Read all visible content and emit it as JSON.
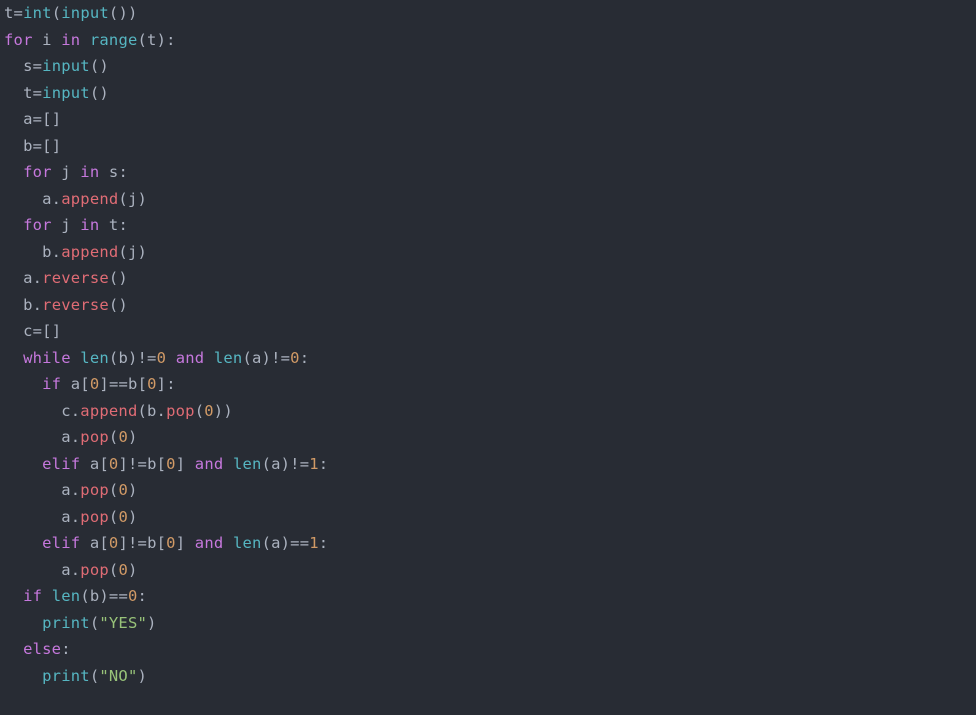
{
  "code": {
    "tokens": [
      [
        {
          "t": "var",
          "v": "t"
        },
        {
          "t": "op",
          "v": "="
        },
        {
          "t": "func",
          "v": "int"
        },
        {
          "t": "punc",
          "v": "("
        },
        {
          "t": "func",
          "v": "input"
        },
        {
          "t": "punc",
          "v": "())"
        }
      ],
      [
        {
          "t": "kw",
          "v": "for"
        },
        {
          "t": "var",
          "v": " i "
        },
        {
          "t": "kw",
          "v": "in"
        },
        {
          "t": "var",
          "v": " "
        },
        {
          "t": "func",
          "v": "range"
        },
        {
          "t": "punc",
          "v": "(t):"
        }
      ],
      [
        {
          "t": "var",
          "v": "  s"
        },
        {
          "t": "op",
          "v": "="
        },
        {
          "t": "func",
          "v": "input"
        },
        {
          "t": "punc",
          "v": "()"
        }
      ],
      [
        {
          "t": "var",
          "v": "  t"
        },
        {
          "t": "op",
          "v": "="
        },
        {
          "t": "func",
          "v": "input"
        },
        {
          "t": "punc",
          "v": "()"
        }
      ],
      [
        {
          "t": "var",
          "v": "  a"
        },
        {
          "t": "op",
          "v": "="
        },
        {
          "t": "punc",
          "v": "[]"
        }
      ],
      [
        {
          "t": "var",
          "v": "  b"
        },
        {
          "t": "op",
          "v": "="
        },
        {
          "t": "punc",
          "v": "[]"
        }
      ],
      [
        {
          "t": "var",
          "v": "  "
        },
        {
          "t": "kw",
          "v": "for"
        },
        {
          "t": "var",
          "v": " j "
        },
        {
          "t": "kw",
          "v": "in"
        },
        {
          "t": "var",
          "v": " s"
        },
        {
          "t": "punc",
          "v": ":"
        }
      ],
      [
        {
          "t": "var",
          "v": "    a"
        },
        {
          "t": "punc",
          "v": "."
        },
        {
          "t": "method",
          "v": "append"
        },
        {
          "t": "punc",
          "v": "(j)"
        }
      ],
      [
        {
          "t": "var",
          "v": "  "
        },
        {
          "t": "kw",
          "v": "for"
        },
        {
          "t": "var",
          "v": " j "
        },
        {
          "t": "kw",
          "v": "in"
        },
        {
          "t": "var",
          "v": " t"
        },
        {
          "t": "punc",
          "v": ":"
        }
      ],
      [
        {
          "t": "var",
          "v": "    b"
        },
        {
          "t": "punc",
          "v": "."
        },
        {
          "t": "method",
          "v": "append"
        },
        {
          "t": "punc",
          "v": "(j)"
        }
      ],
      [
        {
          "t": "var",
          "v": "  a"
        },
        {
          "t": "punc",
          "v": "."
        },
        {
          "t": "method",
          "v": "reverse"
        },
        {
          "t": "punc",
          "v": "()"
        }
      ],
      [
        {
          "t": "var",
          "v": "  b"
        },
        {
          "t": "punc",
          "v": "."
        },
        {
          "t": "method",
          "v": "reverse"
        },
        {
          "t": "punc",
          "v": "()"
        }
      ],
      [
        {
          "t": "var",
          "v": "  c"
        },
        {
          "t": "op",
          "v": "="
        },
        {
          "t": "punc",
          "v": "[]"
        }
      ],
      [
        {
          "t": "var",
          "v": "  "
        },
        {
          "t": "kw",
          "v": "while"
        },
        {
          "t": "var",
          "v": " "
        },
        {
          "t": "func",
          "v": "len"
        },
        {
          "t": "punc",
          "v": "(b)"
        },
        {
          "t": "op",
          "v": "!="
        },
        {
          "t": "num",
          "v": "0"
        },
        {
          "t": "var",
          "v": " "
        },
        {
          "t": "kw",
          "v": "and"
        },
        {
          "t": "var",
          "v": " "
        },
        {
          "t": "func",
          "v": "len"
        },
        {
          "t": "punc",
          "v": "(a)"
        },
        {
          "t": "op",
          "v": "!="
        },
        {
          "t": "num",
          "v": "0"
        },
        {
          "t": "punc",
          "v": ":"
        }
      ],
      [
        {
          "t": "var",
          "v": "    "
        },
        {
          "t": "kw",
          "v": "if"
        },
        {
          "t": "var",
          "v": " a"
        },
        {
          "t": "punc",
          "v": "["
        },
        {
          "t": "num",
          "v": "0"
        },
        {
          "t": "punc",
          "v": "]"
        },
        {
          "t": "op",
          "v": "=="
        },
        {
          "t": "var",
          "v": "b"
        },
        {
          "t": "punc",
          "v": "["
        },
        {
          "t": "num",
          "v": "0"
        },
        {
          "t": "punc",
          "v": "]:"
        }
      ],
      [
        {
          "t": "var",
          "v": "      c"
        },
        {
          "t": "punc",
          "v": "."
        },
        {
          "t": "method",
          "v": "append"
        },
        {
          "t": "punc",
          "v": "(b."
        },
        {
          "t": "method",
          "v": "pop"
        },
        {
          "t": "punc",
          "v": "("
        },
        {
          "t": "num",
          "v": "0"
        },
        {
          "t": "punc",
          "v": "))"
        }
      ],
      [
        {
          "t": "var",
          "v": "      a"
        },
        {
          "t": "punc",
          "v": "."
        },
        {
          "t": "method",
          "v": "pop"
        },
        {
          "t": "punc",
          "v": "("
        },
        {
          "t": "num",
          "v": "0"
        },
        {
          "t": "punc",
          "v": ")"
        }
      ],
      [
        {
          "t": "var",
          "v": "    "
        },
        {
          "t": "kw",
          "v": "elif"
        },
        {
          "t": "var",
          "v": " a"
        },
        {
          "t": "punc",
          "v": "["
        },
        {
          "t": "num",
          "v": "0"
        },
        {
          "t": "punc",
          "v": "]"
        },
        {
          "t": "op",
          "v": "!="
        },
        {
          "t": "var",
          "v": "b"
        },
        {
          "t": "punc",
          "v": "["
        },
        {
          "t": "num",
          "v": "0"
        },
        {
          "t": "punc",
          "v": "] "
        },
        {
          "t": "kw",
          "v": "and"
        },
        {
          "t": "var",
          "v": " "
        },
        {
          "t": "func",
          "v": "len"
        },
        {
          "t": "punc",
          "v": "(a)"
        },
        {
          "t": "op",
          "v": "!="
        },
        {
          "t": "num",
          "v": "1"
        },
        {
          "t": "punc",
          "v": ":"
        }
      ],
      [
        {
          "t": "var",
          "v": "      a"
        },
        {
          "t": "punc",
          "v": "."
        },
        {
          "t": "method",
          "v": "pop"
        },
        {
          "t": "punc",
          "v": "("
        },
        {
          "t": "num",
          "v": "0"
        },
        {
          "t": "punc",
          "v": ")"
        }
      ],
      [
        {
          "t": "var",
          "v": "      a"
        },
        {
          "t": "punc",
          "v": "."
        },
        {
          "t": "method",
          "v": "pop"
        },
        {
          "t": "punc",
          "v": "("
        },
        {
          "t": "num",
          "v": "0"
        },
        {
          "t": "punc",
          "v": ")"
        }
      ],
      [
        {
          "t": "var",
          "v": "    "
        },
        {
          "t": "kw",
          "v": "elif"
        },
        {
          "t": "var",
          "v": " a"
        },
        {
          "t": "punc",
          "v": "["
        },
        {
          "t": "num",
          "v": "0"
        },
        {
          "t": "punc",
          "v": "]"
        },
        {
          "t": "op",
          "v": "!="
        },
        {
          "t": "var",
          "v": "b"
        },
        {
          "t": "punc",
          "v": "["
        },
        {
          "t": "num",
          "v": "0"
        },
        {
          "t": "punc",
          "v": "] "
        },
        {
          "t": "kw",
          "v": "and"
        },
        {
          "t": "var",
          "v": " "
        },
        {
          "t": "func",
          "v": "len"
        },
        {
          "t": "punc",
          "v": "(a)"
        },
        {
          "t": "op",
          "v": "=="
        },
        {
          "t": "num",
          "v": "1"
        },
        {
          "t": "punc",
          "v": ":"
        }
      ],
      [
        {
          "t": "var",
          "v": "      a"
        },
        {
          "t": "punc",
          "v": "."
        },
        {
          "t": "method",
          "v": "pop"
        },
        {
          "t": "punc",
          "v": "("
        },
        {
          "t": "num",
          "v": "0"
        },
        {
          "t": "punc",
          "v": ")"
        }
      ],
      [
        {
          "t": "var",
          "v": "  "
        },
        {
          "t": "kw",
          "v": "if"
        },
        {
          "t": "var",
          "v": " "
        },
        {
          "t": "func",
          "v": "len"
        },
        {
          "t": "punc",
          "v": "(b)"
        },
        {
          "t": "op",
          "v": "=="
        },
        {
          "t": "num",
          "v": "0"
        },
        {
          "t": "punc",
          "v": ":"
        }
      ],
      [
        {
          "t": "var",
          "v": "    "
        },
        {
          "t": "func",
          "v": "print"
        },
        {
          "t": "punc",
          "v": "("
        },
        {
          "t": "str",
          "v": "\"YES\""
        },
        {
          "t": "punc",
          "v": ")"
        }
      ],
      [
        {
          "t": "var",
          "v": "  "
        },
        {
          "t": "kw",
          "v": "else"
        },
        {
          "t": "punc",
          "v": ":"
        }
      ],
      [
        {
          "t": "var",
          "v": "    "
        },
        {
          "t": "func",
          "v": "print"
        },
        {
          "t": "punc",
          "v": "("
        },
        {
          "t": "str",
          "v": "\"NO\""
        },
        {
          "t": "punc",
          "v": ")"
        }
      ]
    ]
  }
}
